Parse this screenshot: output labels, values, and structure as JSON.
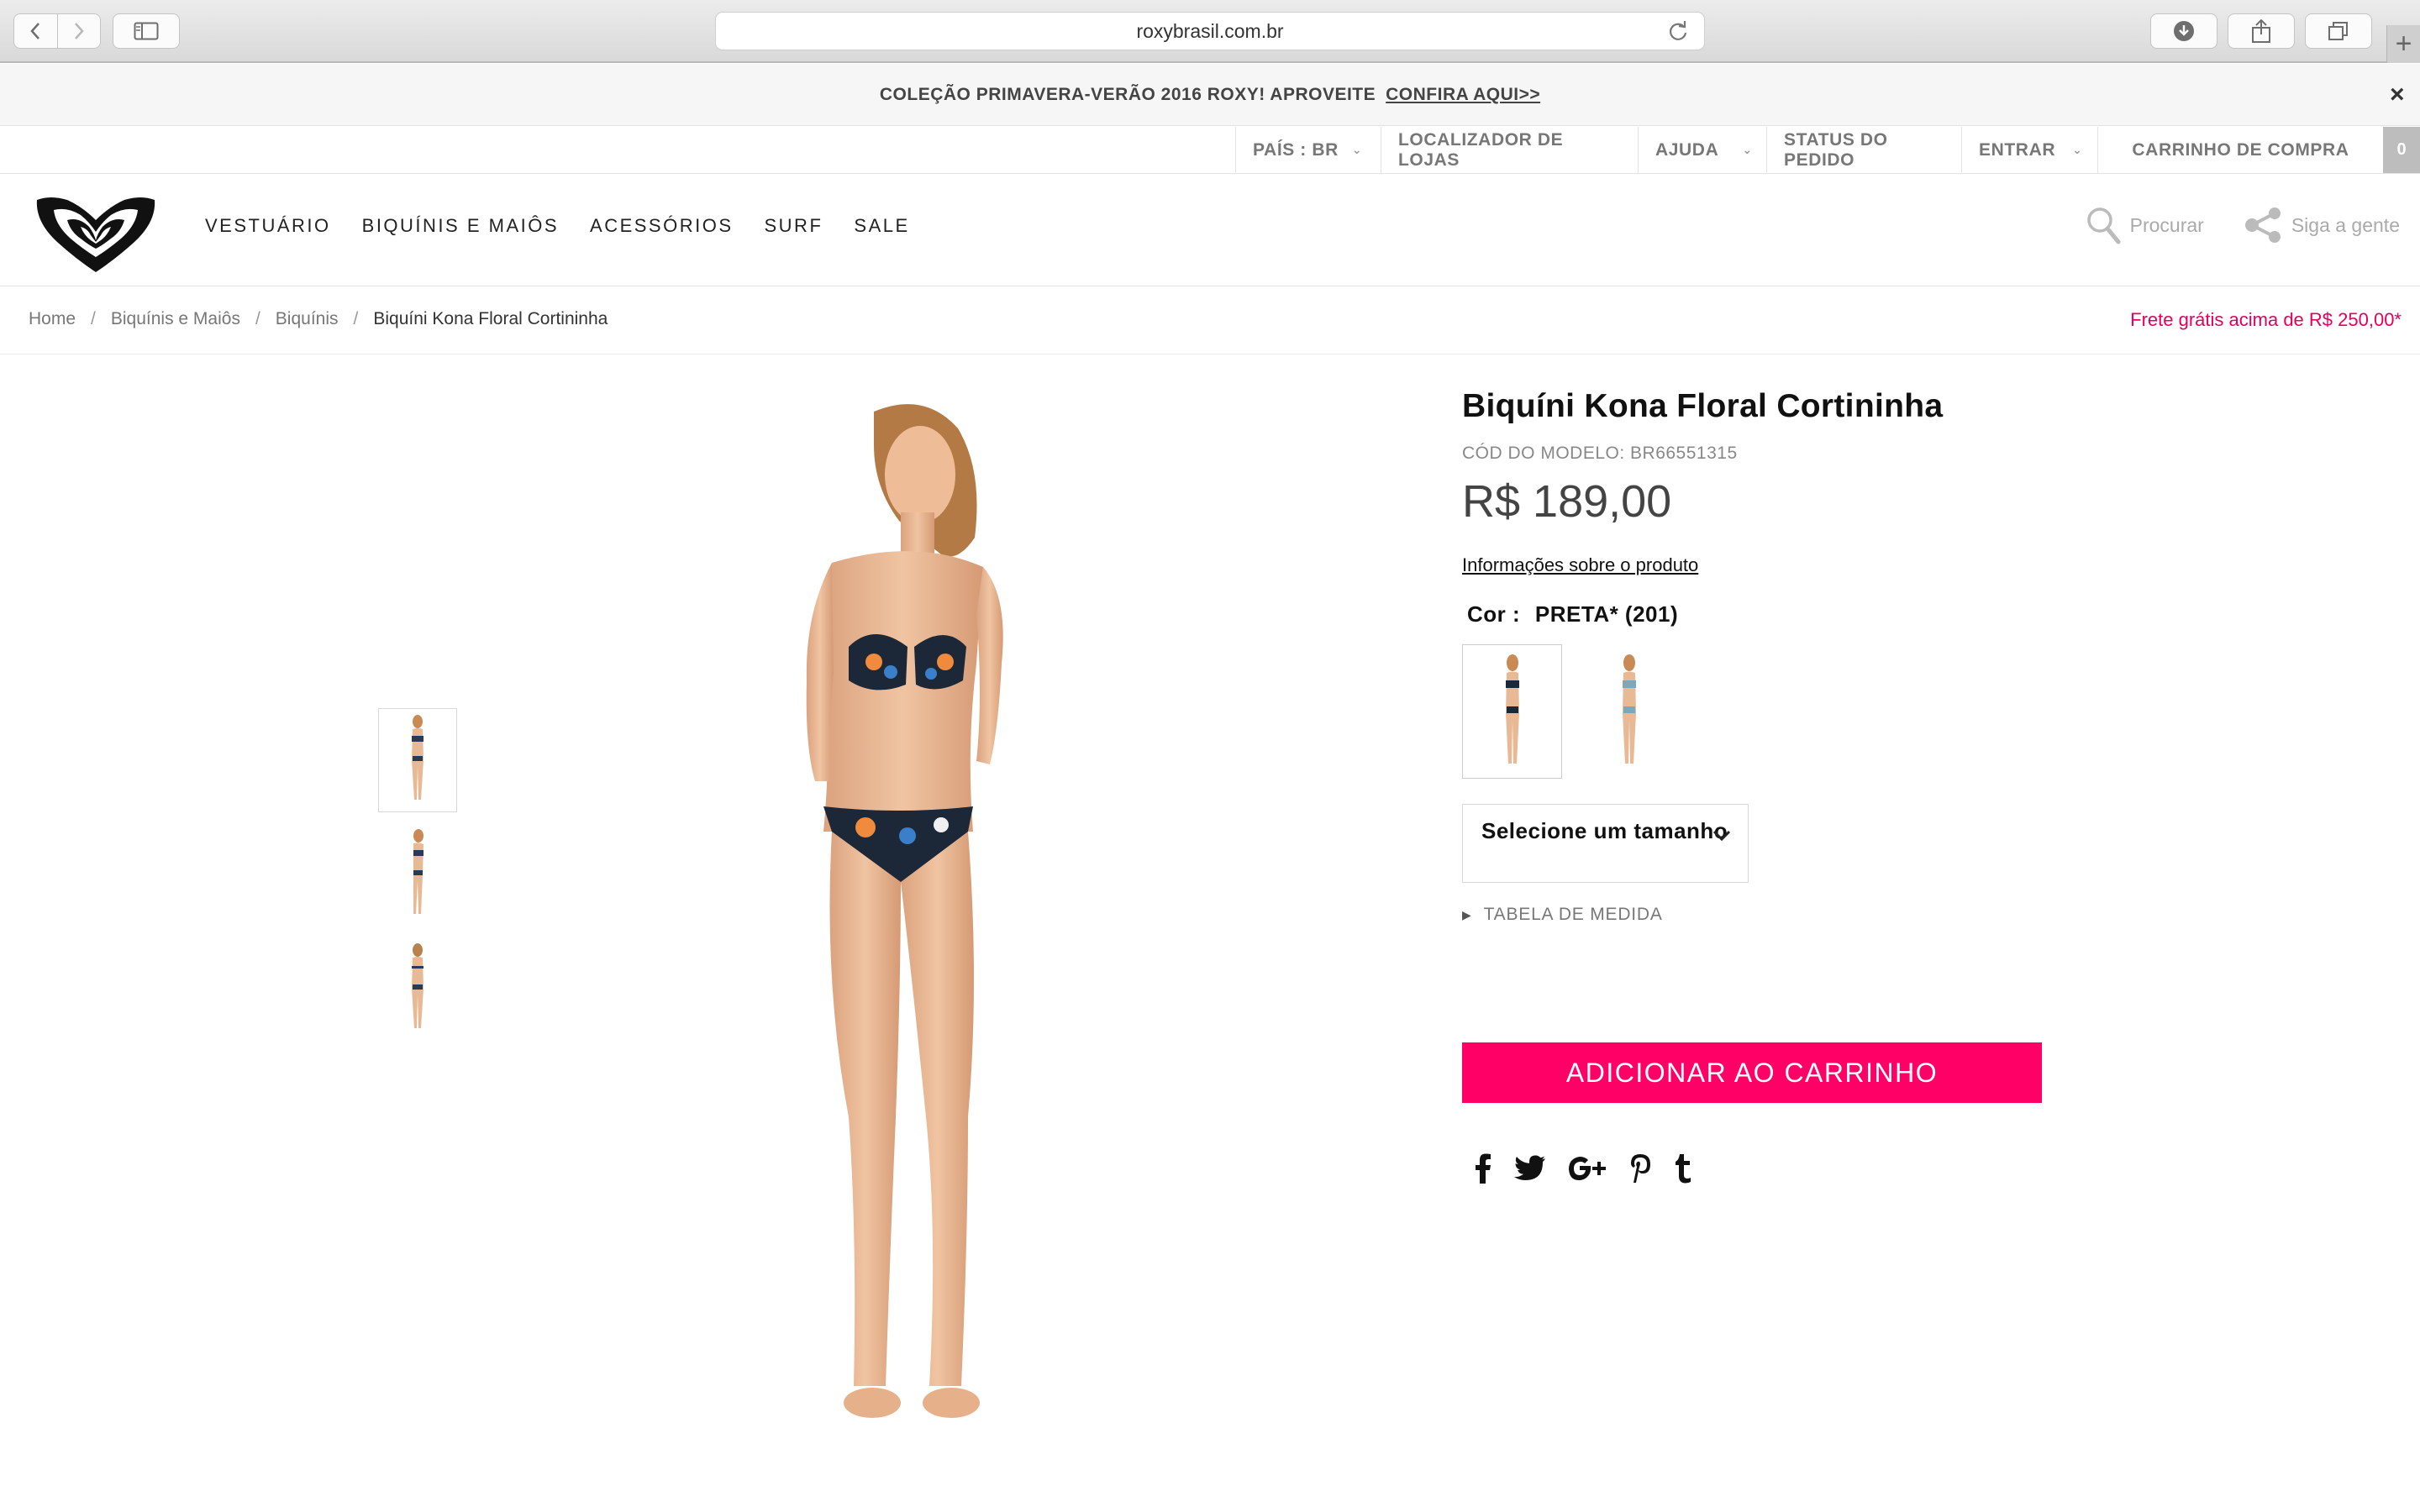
{
  "browser": {
    "url": "roxybrasil.com.br",
    "new_tab": "+"
  },
  "promo": {
    "text": "COLEÇÃO PRIMAVERA-VERÃO 2016 ROXY! APROVEITE",
    "link": "CONFIRA AQUI>>",
    "close": "×"
  },
  "utility": {
    "country": "PAÍS : BR",
    "stores": "LOCALIZADOR DE LOJAS",
    "help": "AJUDA",
    "order_status": "STATUS DO PEDIDO",
    "login": "ENTRAR",
    "cart": "CARRINHO DE COMPRA",
    "cart_count": "0",
    "caret": "⌄"
  },
  "nav": {
    "items": [
      "VESTUÁRIO",
      "BIQUÍNIS E MAIÔS",
      "ACESSÓRIOS",
      "SURF",
      "SALE"
    ],
    "search": "Procurar",
    "follow": "Siga a gente"
  },
  "breadcrumb": {
    "items": [
      "Home",
      "Biquínis e Maiôs",
      "Biquínis"
    ],
    "current": "Biquíni Kona Floral Cortininha",
    "sep": "/"
  },
  "shipping_note": "Frete grátis acima de R$ 250,00*",
  "product": {
    "title": "Biquíni Kona Floral Cortininha",
    "code": "CÓD DO MODELO: BR66551315",
    "price": "R$ 189,00",
    "info_link": "Informações sobre o produto",
    "color_label": "Cor :",
    "color_value": "PRETA* (201)",
    "size_placeholder": "Selecione um tamanho",
    "size_table": "TABELA DE MEDIDA",
    "add_to_cart": "ADICIONAR AO CARRINHO"
  },
  "colors": {
    "accent": "#ff0066",
    "free_shipping": "#e6005c"
  },
  "icons": {
    "social": [
      "facebook-icon",
      "twitter-icon",
      "google-plus-icon",
      "pinterest-icon",
      "tumblr-icon"
    ]
  }
}
